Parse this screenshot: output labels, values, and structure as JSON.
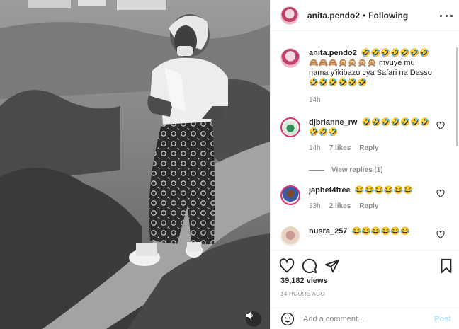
{
  "post": {
    "username": "anita.pendo2",
    "separator": "•",
    "follow_status": "Following",
    "caption_user": "anita.pendo2",
    "caption_text": "🤣🤣🤣🤣🤣🤣🤣 🙈🙈🙈🙊🙊🙊🙊 mvuye mu nama y'ikibazo cya Safari na Dasso 🤣🤣🤣🤣🤣🤣",
    "caption_time": "14h",
    "views": "39,182 views",
    "time_ago": "14 HOURS AGO"
  },
  "comments": [
    {
      "user": "djbrianne_rw",
      "text": "🤣🤣🤣🤣🤣🤣🤣🤣🤣🤣",
      "time": "14h",
      "likes": "7 likes",
      "reply": "Reply",
      "view_replies": "View replies (1)"
    },
    {
      "user": "japhet4free",
      "text": "😂😂😂😂😂😂",
      "time": "13h",
      "likes": "2 likes",
      "reply": "Reply"
    },
    {
      "user": "nusra_257",
      "text": "😂😂😂😂😂😂"
    }
  ],
  "add_comment": {
    "placeholder": "Add a comment...",
    "post_label": "Post"
  },
  "icons": [
    "more-icon",
    "heart-icon",
    "comment-icon",
    "share-icon",
    "save-icon",
    "emoji-icon",
    "sound-icon"
  ]
}
